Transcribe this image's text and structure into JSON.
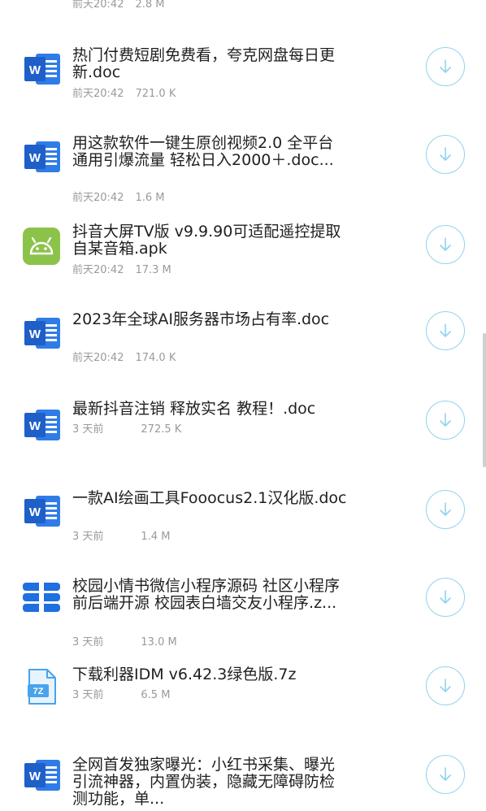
{
  "top_item": {
    "time": "前天20:42",
    "size": "2.8 M"
  },
  "files": [
    {
      "title": "热门付费短剧免费看，夸克网盘每日更新.doc",
      "time": "前天20:42",
      "size": "721.0 K",
      "icon": "word-doc-icon"
    },
    {
      "title": "用这款软件一键生原创视频2.0 全平台通用引爆流量 轻松日入2000＋.doc...",
      "time": "前天20:42",
      "size": "1.6 M",
      "icon": "word-doc-icon"
    },
    {
      "title": "抖音大屏TV版 v9.9.90可适配遥控提取自某音箱.apk",
      "time": "前天20:42",
      "size": "17.3 M",
      "icon": "android-apk-icon"
    },
    {
      "title": "2023年全球AI服务器市场占有率.doc",
      "time": "前天20:42",
      "size": "174.0 K",
      "icon": "word-doc-icon"
    },
    {
      "title": "最新抖音注销 释放实名 教程！.doc",
      "time": "3 天前",
      "size": "272.5 K",
      "icon": "word-doc-icon"
    },
    {
      "title": "一款AI绘画工具Fooocus2.1汉化版.doc",
      "time": "3 天前",
      "size": "1.4 M",
      "icon": "word-doc-icon"
    },
    {
      "title": "校园小情书微信小程序源码 社区小程序前后端开源 校园表白墙交友小程序.z...",
      "time": "3 天前",
      "size": "13.0 M",
      "icon": "archive-icon"
    },
    {
      "title": "下载利器IDM v6.42.3绿色版.7z",
      "time": "3 天前",
      "size": "6.5 M",
      "icon": "7z-file-icon"
    },
    {
      "title": "全网首发独家曝光：小红书采集、曝光引流神器，内置伪装，隐藏无障碍防检测功能，单...",
      "time": "",
      "size": "",
      "icon": "word-doc-icon"
    }
  ],
  "colors": {
    "word_blue": "#2f7ce8",
    "android_green": "#8bc34a",
    "archive_blue": "#1f6fe0",
    "download_ring": "#8fd3ef"
  }
}
